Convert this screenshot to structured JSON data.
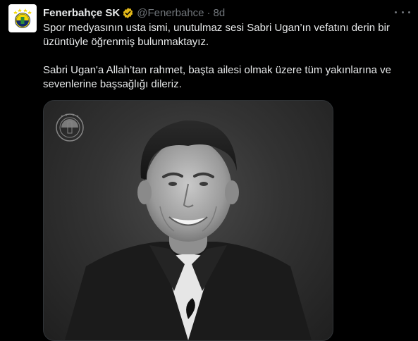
{
  "account": {
    "name": "Fenerbahçe SK",
    "handle": "@Fenerbahce",
    "separator": "·",
    "time": "8d"
  },
  "icons": {
    "verified": "verified-badge-icon",
    "more": "more-options-icon",
    "avatar": "fenerbahce-crest-logo",
    "watermark": "fenerbahce-crest-watermark"
  },
  "colors": {
    "background": "#000000",
    "text": "#e7e9ea",
    "secondary": "#71767b",
    "verified": "#e2b719",
    "crest_yellow": "#f5d800",
    "crest_navy": "#102a6b"
  },
  "post": {
    "paragraph_1": "Spor medyasının usta ismi, unutulmaz sesi Sabri Ugan’ın vefatını derin bir üzüntüyle öğrenmiş bulunmaktayız.",
    "paragraph_2": "Sabri Ugan'a Allah’tan rahmet, başta ailesi olmak üzere tüm yakınlarına ve sevenlerine başsağlığı dileriz."
  },
  "media": {
    "type": "black-and-white portrait photo"
  }
}
